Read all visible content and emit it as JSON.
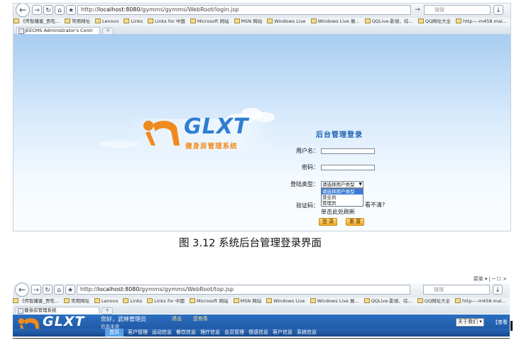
{
  "browser": {
    "url_prefix": "http://",
    "url_host": "localhost:8080",
    "url_path_login": "/gymms/gymms/WebRoot/login.jsp",
    "url_path_top": "/gymms/gymms/WebRoot/top.jsp",
    "search_placeholder": "搜搜",
    "favorites": [
      "《传智播客_贡吃...",
      "常用网址",
      "Lenovo",
      "Links",
      "Links for 中国",
      "Microsoft 网站",
      "MSN 网站",
      "Windows Live",
      "Windows Live 展...",
      "QQLive-影视、综...",
      "QQ网址大全",
      "http----m458.mai..."
    ],
    "tab1_title": "JEECMS Administrator's Contr",
    "tab2_title": "健身房管理系统",
    "menu_label": "菜单",
    "close_x": "×",
    "new_tab": "+"
  },
  "login": {
    "logo_text": "GLXT",
    "logo_sub": "健身房管理系统",
    "form_title": "后台管理登录",
    "username_label": "用户名：",
    "password_label": "密码：",
    "usertype_label": "登陆类型：",
    "usertype_selected": "请选择用户类型",
    "usertype_options": [
      "请选择用户类型",
      "营业员",
      "管理员"
    ],
    "captcha_label": "验证码：",
    "captcha_hint": "看不清?",
    "captcha_refresh": "单击此处刷新",
    "login_button": "登 录",
    "reset_button": "重 置"
  },
  "caption": "图 3.12 系统后台管理登录界面",
  "top_page": {
    "welcome": "您好，武林管理员",
    "welcome_sub": "信息未读",
    "logout": "退出",
    "messages": "您有条",
    "about_select": "关于我们",
    "view_link": "【查看",
    "menu_items": [
      "首页",
      "客户管理",
      "运动信息",
      "餐饮信息",
      "理疗信息",
      "会员管理",
      "情感信息",
      "客户信息",
      "系统信息"
    ]
  }
}
